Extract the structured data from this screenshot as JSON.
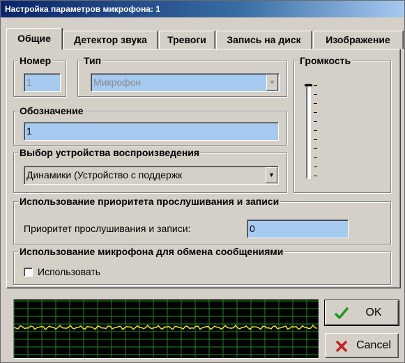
{
  "window": {
    "title": "Настройка параметров микрофона: 1"
  },
  "tabs": [
    {
      "label": "Общие",
      "active": true
    },
    {
      "label": "Детектор звука",
      "active": false
    },
    {
      "label": "Тревоги",
      "active": false
    },
    {
      "label": "Запись на диск",
      "active": false
    },
    {
      "label": "Изображение",
      "active": false
    }
  ],
  "general": {
    "number": {
      "label": "Номер",
      "value": "1"
    },
    "type": {
      "label": "Тип",
      "value": "Микрофон"
    },
    "volume": {
      "label": "Громкость",
      "level": 1.0
    },
    "designation": {
      "label": "Обозначение",
      "value": "1"
    },
    "playback_device": {
      "label": "Выбор устройства воспроизведения",
      "value": "Динамики (Устройство с поддержк"
    },
    "priority": {
      "group_label": "Использование приоритета прослушивания и записи",
      "field_label": "Приоритет прослушивания и записи:",
      "value": "0"
    },
    "messaging": {
      "group_label": "Использование микрофона для обмена сообщениями",
      "checkbox_label": "Использовать",
      "checked": false
    }
  },
  "buttons": {
    "ok_label": "OK",
    "cancel_label": "Cancel"
  },
  "colors": {
    "field_bg": "#a6caf0",
    "scope_bg": "#000000",
    "scope_grid": "#1e8c1e",
    "scope_wave": "#e8f000",
    "ok_check": "#1a9a1a",
    "cancel_x": "#c81e1e"
  },
  "icons": {
    "ok": "checkmark-icon",
    "cancel": "x-icon",
    "combo": "chevron-down-icon"
  }
}
